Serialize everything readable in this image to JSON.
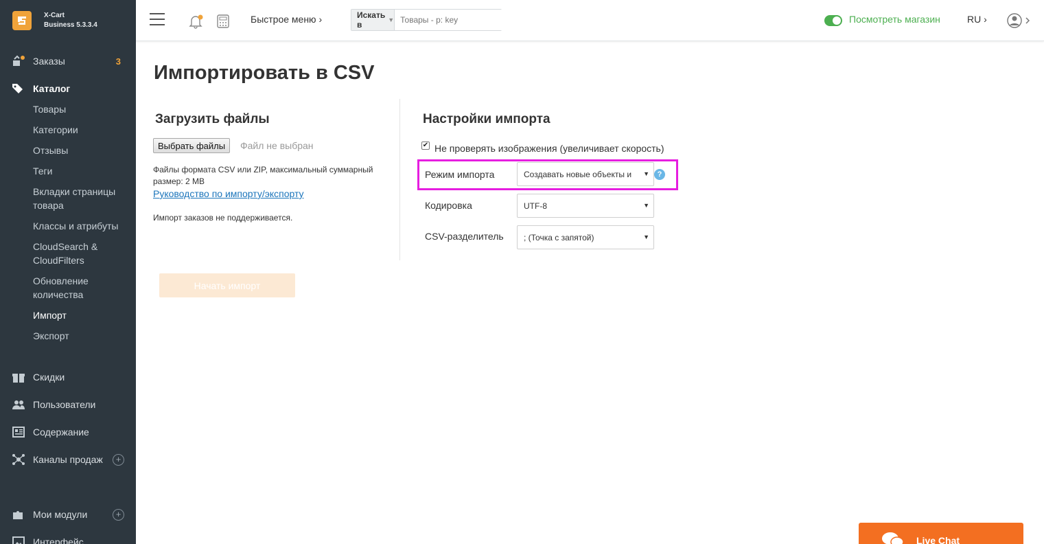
{
  "brand": {
    "name": "X-Cart",
    "version": "Business 5.3.3.4"
  },
  "sidebar": {
    "orders": {
      "label": "Заказы",
      "count": "3"
    },
    "catalog": {
      "label": "Каталог",
      "items": [
        "Товары",
        "Категории",
        "Отзывы",
        "Теги"
      ],
      "tabs_line1": "Вкладки страницы",
      "tabs_line2": "товара",
      "classes": "Классы и атрибуты",
      "cloud_line1": "CloudSearch &",
      "cloud_line2": "CloudFilters",
      "update_line1": "Обновление",
      "update_line2": "количества",
      "import": "Импорт",
      "export": "Экспорт"
    },
    "discounts": "Скидки",
    "users": "Пользователи",
    "content": "Содержание",
    "channels": "Каналы продаж",
    "modules": "Мои модули",
    "interface": "Интерфейс"
  },
  "topbar": {
    "quick_menu": "Быстрое меню ›",
    "search_in": "Искать в",
    "search_placeholder": "Товары - p: key",
    "view_store": "Посмотреть магазин",
    "lang": "RU ›"
  },
  "page": {
    "title": "Импортировать в CSV",
    "upload": {
      "heading": "Загрузить файлы",
      "choose_button": "Выбрать файлы",
      "no_file": "Файл не выбран",
      "note": "Файлы формата CSV или ZIP, максимальный суммарный размер: 2 MB",
      "guide_link": "Руководство по импорту/экспорту",
      "orders_note": "Импорт заказов не поддерживается."
    },
    "settings": {
      "heading": "Настройки импорта",
      "skip_images_label": "Не проверять изображения (увеличивает скорость)",
      "skip_images_checked": true,
      "mode_label": "Режим импорта",
      "mode_value": "Создавать новые объекты и",
      "encoding_label": "Кодировка",
      "encoding_value": "UTF-8",
      "delimiter_label": "CSV-разделитель",
      "delimiter_value": "; (Точка с запятой)"
    },
    "start_button": "Начать импорт"
  },
  "livechat": {
    "label": "Live Chat"
  },
  "colors": {
    "sidebar_bg": "#2d373f",
    "accent": "#f0a33a",
    "green": "#4caf50",
    "highlight": "#e61ee0",
    "livechat": "#f36f21"
  }
}
